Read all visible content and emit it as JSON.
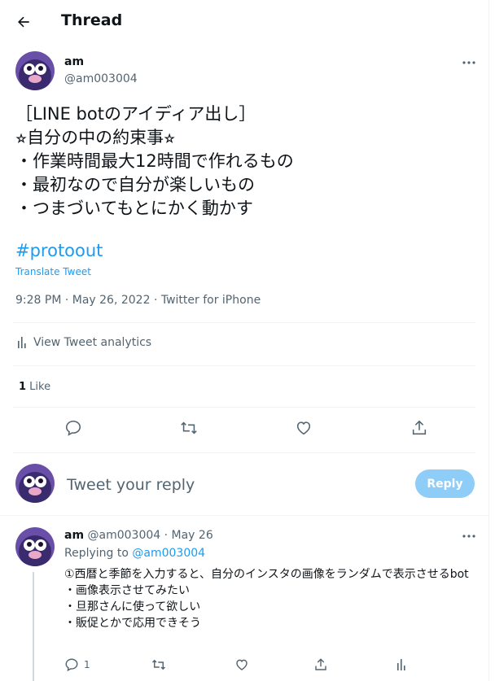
{
  "header": {
    "title": "Thread"
  },
  "tweet": {
    "name": "am",
    "handle": "@am003004",
    "text": "［LINE botのアイディア出し］\n⭐︎自分の中の約束事⭐︎\n・作業時間最大12時間で作れるもの\n・最初なので自分が楽しいもの\n・つまづいてもとにかく動かす",
    "hashtag": "#protoout",
    "translate_label": "Translate Tweet",
    "meta": "9:28 PM · May 26, 2022 · Twitter for iPhone",
    "analytics_label": "View Tweet analytics",
    "likes_count": "1",
    "likes_label": " Like"
  },
  "reply_box": {
    "placeholder": "Tweet your reply",
    "button_label": "Reply"
  },
  "reply": {
    "name": "am",
    "handle": "@am003004",
    "date": " · May 26",
    "replying_prefix": "Replying to ",
    "replying_to": "@am003004",
    "text": "①西暦と季節を入力すると、自分のインスタの画像をランダムで表示させるbot\n・画像表示させてみたい\n・旦那さんに使って欲しい\n・販促とかで応用できそう",
    "reply_count": "1"
  },
  "colors": {
    "accent": "#1d9bf0",
    "muted": "#536471",
    "reply_button": "#8ecdf8"
  }
}
